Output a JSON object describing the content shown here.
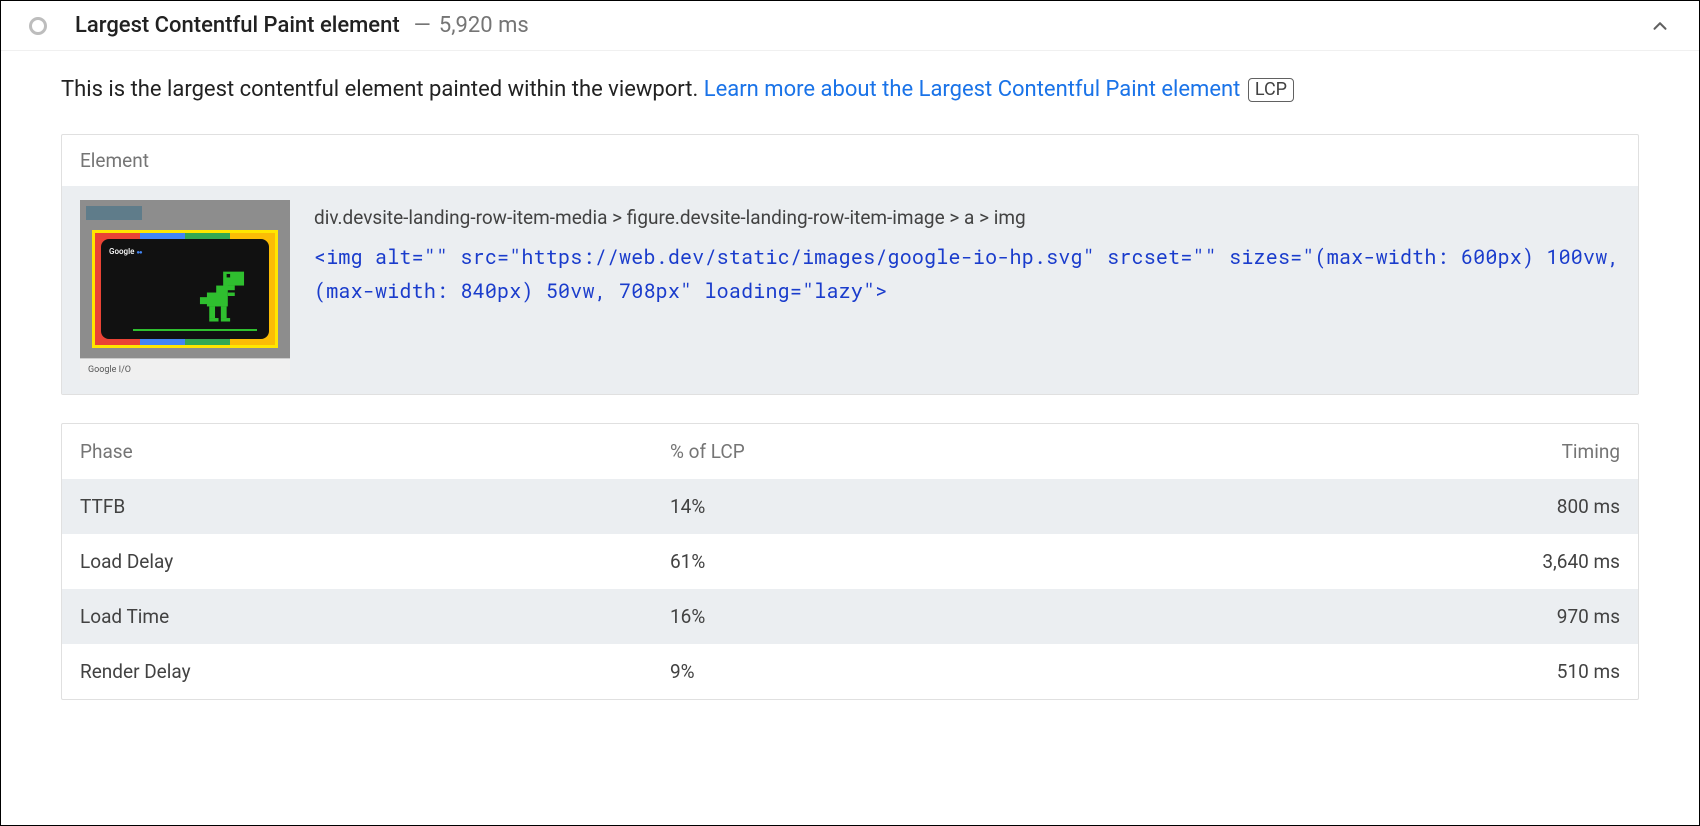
{
  "header": {
    "title": "Largest Contentful Paint element",
    "separator": "—",
    "timing": "5,920 ms"
  },
  "description": {
    "text": "This is the largest contentful element painted within the viewport. ",
    "link_text": "Learn more about the Largest Contentful Paint element",
    "badge": "LCP"
  },
  "element_section": {
    "header": "Element",
    "selector": "div.devsite-landing-row-item-media > figure.devsite-landing-row-item-image > a > img",
    "snippet": "<img alt=\"\" src=\"https://web.dev/static/images/google-io-hp.svg\" srcset=\"\" sizes=\"(max-width: 600px) 100vw, (max-width: 840px) 50vw, 708px\" loading=\"lazy\">",
    "thumb_logo": "Google",
    "thumb_caption": "Google I/O"
  },
  "phase_table": {
    "columns": {
      "phase": "Phase",
      "pct": "% of LCP",
      "timing": "Timing"
    },
    "rows": [
      {
        "phase": "TTFB",
        "pct": "14%",
        "timing": "800 ms"
      },
      {
        "phase": "Load Delay",
        "pct": "61%",
        "timing": "3,640 ms"
      },
      {
        "phase": "Load Time",
        "pct": "16%",
        "timing": "970 ms"
      },
      {
        "phase": "Render Delay",
        "pct": "9%",
        "timing": "510 ms"
      }
    ]
  }
}
